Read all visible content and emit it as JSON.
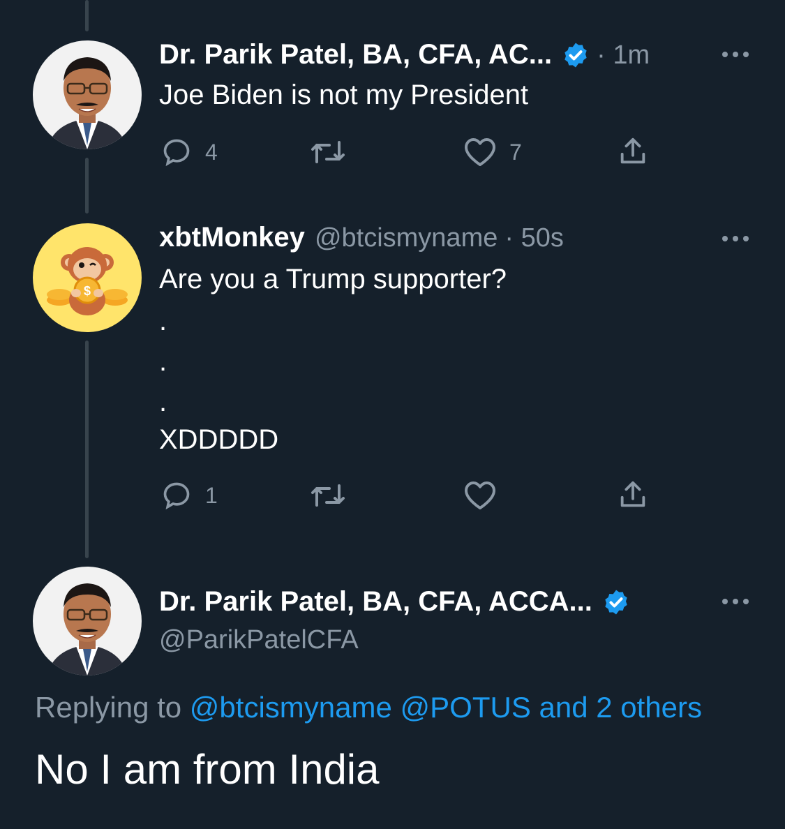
{
  "tweet1": {
    "name": "Dr. Parik Patel, BA, CFA, AC...",
    "time": "· 1m",
    "text": "Joe Biden is not my President",
    "reply_count": "4",
    "retweet_count": "",
    "like_count": "7"
  },
  "tweet2": {
    "name": "xbtMonkey",
    "handle": "@btcismyname",
    "time": "· 50s",
    "text_line1": "Are you a Trump supporter?",
    "dot1": ".",
    "dot2": ".",
    "dot3": ".",
    "text_last": "XDDDDD",
    "reply_count": "1",
    "retweet_count": "",
    "like_count": ""
  },
  "tweet3": {
    "name": "Dr. Parik Patel, BA, CFA, ACCA...",
    "handle": "@ParikPatelCFA",
    "replying_label": "Replying to",
    "mention1": "@btcismyname",
    "mention2": "@POTUS",
    "mention_rest": "and 2 others",
    "text": "No I am from India"
  },
  "colors": {
    "background": "#15202b",
    "verified": "#1d9bf0",
    "secondary_text": "#8b98a5",
    "thread_line": "#38444d",
    "link": "#1d9bf0"
  },
  "icons": [
    "reply-icon",
    "retweet-icon",
    "like-icon",
    "share-icon",
    "verified-badge-icon",
    "more-options-icon"
  ]
}
